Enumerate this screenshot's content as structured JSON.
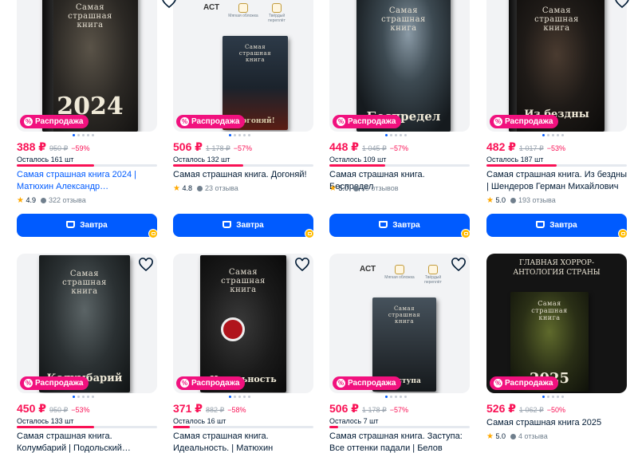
{
  "colors": {
    "accent": "#005bff",
    "price": "#f91155",
    "sale": "#f1117e",
    "star": "#ffa800"
  },
  "icons": {
    "favorite": "heart-outline-icon",
    "sale": "percent-icon",
    "cart": "cart-icon",
    "rating": "star-icon",
    "reviews": "chat-bubble-icon"
  },
  "products": [
    {
      "sale": "Распродажа",
      "price": "388 ₽",
      "old_price": "950 ₽",
      "discount": "−59%",
      "stock": "Осталось 161 шт",
      "stock_fraction": 0.55,
      "title": "Самая страшная книга 2024 | Матюхин Александр…",
      "rating": "4.9",
      "reviews": "322 отзыва",
      "cart": "Завтра",
      "cover_title": "Самая страшная книга",
      "cover_year": "2024"
    },
    {
      "sale": "Распродажа",
      "price": "506 ₽",
      "old_price": "1 178 ₽",
      "discount": "−57%",
      "stock": "Осталось 132 шт",
      "stock_fraction": 0.5,
      "title": "Самая страшная книга. Догоняй!",
      "rating": "4.8",
      "reviews": "23 отзыва",
      "cart": "Завтра",
      "cover_title": "Самая страшная книга",
      "cover_year": "Догоняй!",
      "pub_labels": [
        "АСТ",
        "Мягкая обложка",
        "Твёрдый переплёт"
      ]
    },
    {
      "sale": "Распродажа",
      "price": "448 ₽",
      "old_price": "1 045 ₽",
      "discount": "−57%",
      "stock": "Осталось 109 шт",
      "stock_fraction": 0.4,
      "title": "Самая страшная книга. Беспредел",
      "rating": "5.0",
      "reviews": "55 отзывов",
      "cart": "Завтра",
      "cover_title": "Самая страшная книга",
      "cover_year": "Беспредел"
    },
    {
      "sale": "Распродажа",
      "price": "482 ₽",
      "old_price": "1 017 ₽",
      "discount": "−53%",
      "stock": "Осталось 187 шт",
      "stock_fraction": 0.5,
      "title": "Самая страшная книга. Из бездны | Шендеров Герман Михайлович",
      "rating": "5.0",
      "reviews": "193 отзыва",
      "cart": "Завтра",
      "cover_title": "Самая страшная книга",
      "cover_year": "Из бездны"
    },
    {
      "sale": "Распродажа",
      "price": "450 ₽",
      "old_price": "950 ₽",
      "discount": "−53%",
      "stock": "Осталось 133 шт",
      "stock_fraction": 0.55,
      "title": "Самая страшная книга. Колумбарий | Подольский…",
      "cover_title": "Самая страшная книга",
      "cover_year": "Колумбарий"
    },
    {
      "sale": "Распродажа",
      "price": "371 ₽",
      "old_price": "882 ₽",
      "discount": "−58%",
      "stock": "Осталось 16 шт",
      "stock_fraction": 0.12,
      "title": "Самая страшная книга. Идеальность. | Матюхин Александ…",
      "cover_title": "Самая страшная книга",
      "cover_year": "Идеальность"
    },
    {
      "sale": "Распродажа",
      "price": "506 ₽",
      "old_price": "1 178 ₽",
      "discount": "−57%",
      "stock": "Осталось 7 шт",
      "stock_fraction": 0.06,
      "title": "Самая страшная книга. Заступа: Все оттенки падали | Белов Иван…",
      "cover_title": "Самая страшная книга",
      "cover_year": "Заступа",
      "pub_labels": [
        "АСТ",
        "Мягкая обложка",
        "Твёрдый переплёт"
      ]
    },
    {
      "sale": "Распродажа",
      "price": "526 ₽",
      "old_price": "1 062 ₽",
      "discount": "−50%",
      "stock": "",
      "stock_fraction": 0.5,
      "title": "Самая страшная книга 2025",
      "rating": "5.0",
      "reviews": "4 отзыва",
      "cover_title": "Самая страшная книга",
      "cover_year": "2025",
      "cover_header": "ГЛАВНАЯ ХОРРОР-АНТОЛОГИЯ СТРАНЫ"
    }
  ]
}
